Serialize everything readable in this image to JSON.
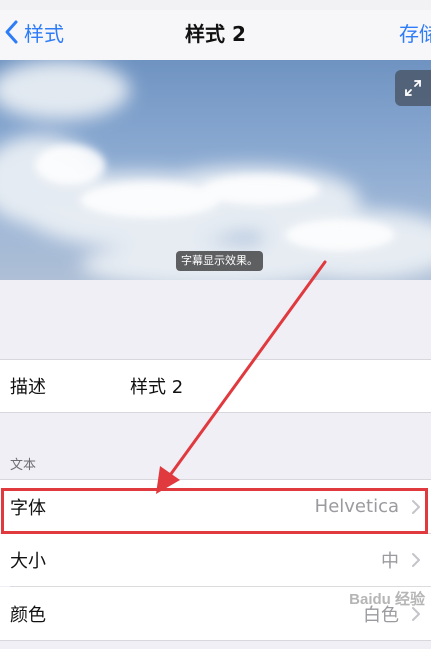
{
  "navbar": {
    "back_label": "样式",
    "title": "样式 2",
    "save_label": "存储"
  },
  "preview": {
    "caption": "字幕显示效果。",
    "expand_icon": "expand-icon"
  },
  "form": {
    "description": {
      "label": "描述",
      "value": "样式 2"
    },
    "section_header": "文本",
    "font": {
      "label": "字体",
      "value": "Helvetica"
    },
    "size": {
      "label": "大小",
      "value": "中"
    },
    "color": {
      "label": "颜色",
      "value": "白色"
    }
  },
  "colors": {
    "accent": "#2e7cf6",
    "annotation": "#e0393e"
  }
}
